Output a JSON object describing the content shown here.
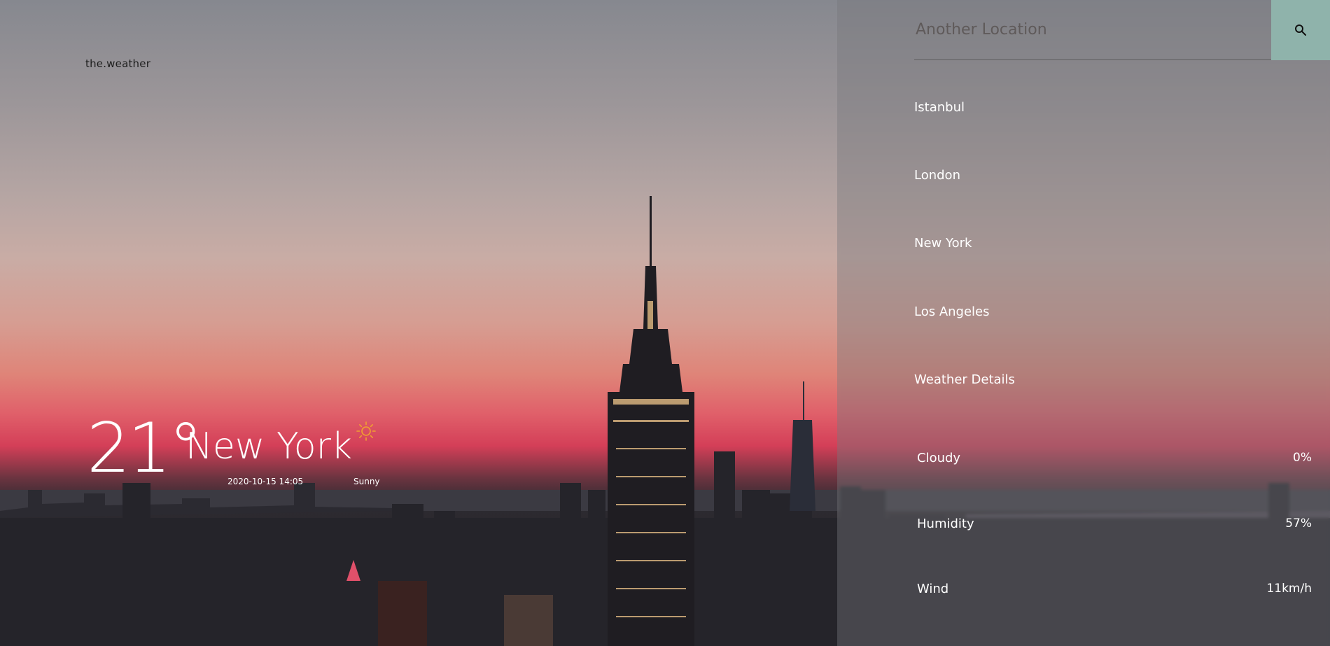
{
  "brand": "the.weather",
  "current": {
    "temperature": "21°",
    "city": "New York",
    "datetime": "2020-10-15 14:05",
    "condition": "Sunny",
    "icon": "sun-icon"
  },
  "search": {
    "placeholder": "Another Location",
    "icon": "search-icon"
  },
  "locations": [
    "Istanbul",
    "London",
    "New York",
    "Los Angeles"
  ],
  "details": {
    "title": "Weather Details",
    "rows": [
      {
        "label": "Cloudy",
        "value": "0%"
      },
      {
        "label": "Humidity",
        "value": "57%"
      },
      {
        "label": "Wind",
        "value": "11km/h"
      }
    ]
  },
  "colors": {
    "accent": "#8fb3ab",
    "sun": "#f0a030"
  }
}
